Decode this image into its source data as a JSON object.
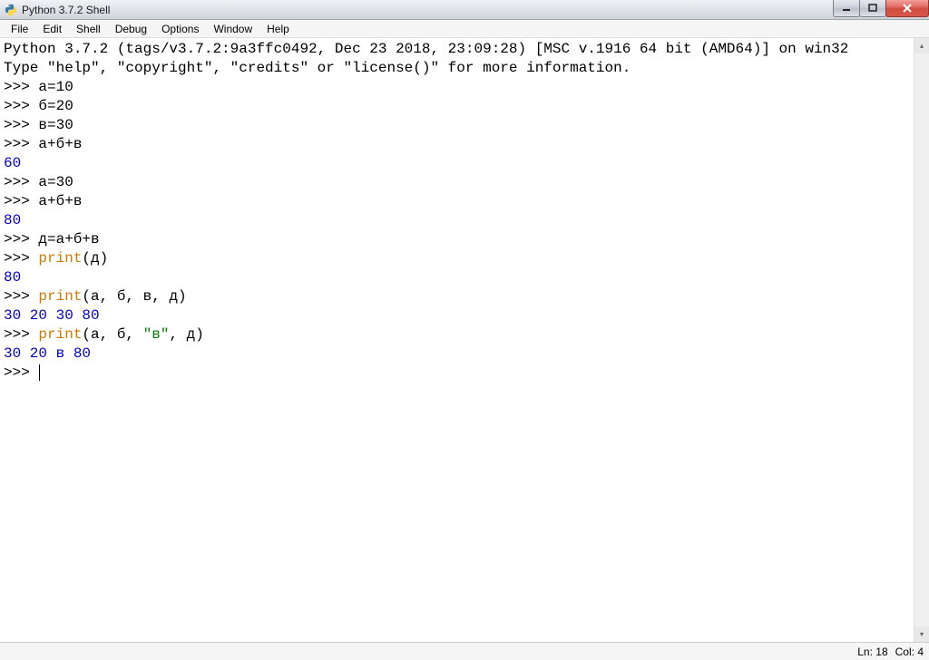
{
  "window": {
    "title": "Python 3.7.2 Shell"
  },
  "menu": {
    "items": [
      "File",
      "Edit",
      "Shell",
      "Debug",
      "Options",
      "Window",
      "Help"
    ]
  },
  "shell": {
    "banner1": "Python 3.7.2 (tags/v3.7.2:9a3ffc0492, Dec 23 2018, 23:09:28) [MSC v.1916 64 bit (AMD64)] on win32",
    "banner2": "Type \"help\", \"copyright\", \"credits\" or \"license()\" for more information.",
    "prompt": ">>> ",
    "lines": [
      {
        "in": "а=10"
      },
      {
        "in": "б=20"
      },
      {
        "in": "в=30"
      },
      {
        "in": "а+б+в"
      },
      {
        "out": "60"
      },
      {
        "in": "а=30"
      },
      {
        "in": "а+б+в"
      },
      {
        "out": "80"
      },
      {
        "in": "д=а+б+в"
      },
      {
        "in_call": {
          "fn": "print",
          "args": "(д)"
        }
      },
      {
        "out": "80"
      },
      {
        "in_call": {
          "fn": "print",
          "args": "(а, б, в, д)"
        }
      },
      {
        "out": "30 20 30 80"
      },
      {
        "in_call": {
          "fn": "print",
          "args_pre": "(а, б, ",
          "str": "\"в\"",
          "args_post": ", д)"
        }
      },
      {
        "out": "30 20 в 80"
      }
    ]
  },
  "status": {
    "ln_label": "Ln:",
    "ln": "18",
    "col_label": "Col:",
    "col": "4"
  }
}
